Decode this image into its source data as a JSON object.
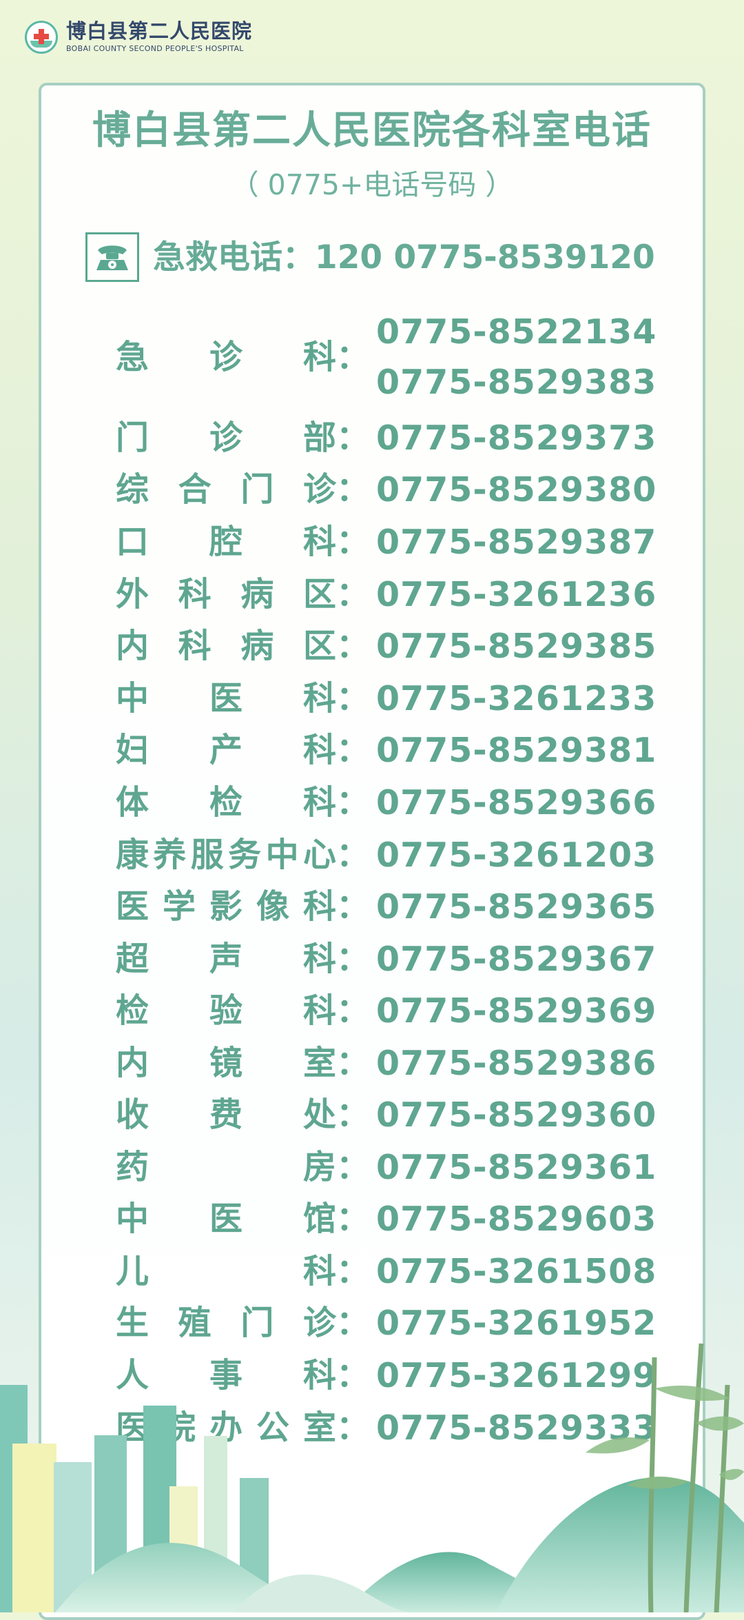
{
  "hospital": {
    "logo_cn": "博白县第二人民医院",
    "logo_en": "BOBAI COUNTY SECOND PEOPLE'S HOSPITAL"
  },
  "title": "博白县第二人民医院各科室电话",
  "subtitle": "（ 0775+电话号码 ）",
  "emergency": "急救电话：120  0775-8539120",
  "departments": [
    {
      "name": [
        "急",
        "诊",
        "科"
      ],
      "phones": [
        "0775-8522134",
        "0775-8529383"
      ]
    },
    {
      "name": [
        "门",
        "诊",
        "部"
      ],
      "phones": [
        "0775-8529373"
      ]
    },
    {
      "name": [
        "综",
        "合",
        "门",
        "诊"
      ],
      "phones": [
        "0775-8529380"
      ]
    },
    {
      "name": [
        "口",
        "腔",
        "科"
      ],
      "phones": [
        "0775-8529387"
      ]
    },
    {
      "name": [
        "外",
        "科",
        "病",
        "区"
      ],
      "phones": [
        "0775-3261236"
      ]
    },
    {
      "name": [
        "内",
        "科",
        "病",
        "区"
      ],
      "phones": [
        "0775-8529385"
      ]
    },
    {
      "name": [
        "中",
        "医",
        "科"
      ],
      "phones": [
        "0775-3261233"
      ]
    },
    {
      "name": [
        "妇",
        "产",
        "科"
      ],
      "phones": [
        "0775-8529381"
      ]
    },
    {
      "name": [
        "体",
        "检",
        "科"
      ],
      "phones": [
        "0775-8529366"
      ]
    },
    {
      "name": [
        "康",
        "养",
        "服",
        "务",
        "中",
        "心"
      ],
      "phones": [
        "0775-3261203"
      ]
    },
    {
      "name": [
        "医",
        "学",
        "影",
        "像",
        "科"
      ],
      "phones": [
        "0775-8529365"
      ]
    },
    {
      "name": [
        "超",
        "声",
        "科"
      ],
      "phones": [
        "0775-8529367"
      ]
    },
    {
      "name": [
        "检",
        "验",
        "科"
      ],
      "phones": [
        "0775-8529369"
      ]
    },
    {
      "name": [
        "内",
        "镜",
        "室"
      ],
      "phones": [
        "0775-8529386"
      ]
    },
    {
      "name": [
        "收",
        "费",
        "处"
      ],
      "phones": [
        "0775-8529360"
      ]
    },
    {
      "name": [
        "药",
        "房"
      ],
      "phones": [
        "0775-8529361"
      ]
    },
    {
      "name": [
        "中",
        "医",
        "馆"
      ],
      "phones": [
        "0775-8529603"
      ]
    },
    {
      "name": [
        "儿",
        "科"
      ],
      "phones": [
        "0775-3261508"
      ]
    },
    {
      "name": [
        "生",
        "殖",
        "门",
        "诊"
      ],
      "phones": [
        "0775-3261952"
      ]
    },
    {
      "name": [
        "人",
        "事",
        "科"
      ],
      "phones": [
        "0775-3261299"
      ]
    },
    {
      "name": [
        "医",
        "院",
        "办",
        "公",
        "室"
      ],
      "phones": [
        "0775-8529333"
      ]
    }
  ],
  "colors": {
    "accent": "#5fa690",
    "panel_border": "#a7cfc2",
    "logo_text": "#34496b"
  },
  "icons": [
    "hospital-logo-icon",
    "phone-icon"
  ]
}
